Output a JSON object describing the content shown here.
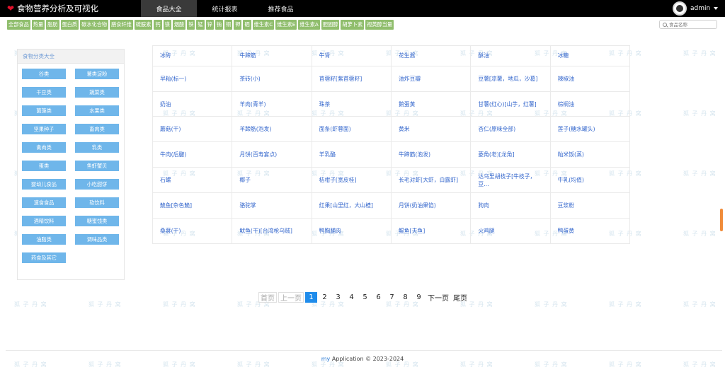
{
  "app": {
    "title": "食物营养分析及可视化"
  },
  "nav": {
    "tabs": [
      {
        "label": "食品大全"
      },
      {
        "label": "统计报表"
      },
      {
        "label": "推荐食品"
      }
    ]
  },
  "user": {
    "name": "admin"
  },
  "categories": [
    "全部食品",
    "热量",
    "脂肪",
    "蛋白质",
    "碳水化合物",
    "膳食纤维",
    "硫胺素",
    "钙",
    "镁",
    "烟酸",
    "铁",
    "锰",
    "锌",
    "钠",
    "铜",
    "钾",
    "硒",
    "维生素C",
    "维生素E",
    "维生素A",
    "胆固醇",
    "胡萝卜素",
    "视黄醇当量"
  ],
  "search": {
    "placeholder": "食品名称"
  },
  "sidebar": {
    "title": "食物分类大全",
    "items": [
      "谷类",
      "薯类淀粉",
      "干豆类",
      "蔬菜类",
      "菌藻类",
      "水果类",
      "坚果种子",
      "畜肉类",
      "禽肉类",
      "乳类",
      "蛋类",
      "鱼虾蟹贝",
      "婴幼儿食品",
      "小吃甜饼",
      "速食食品",
      "软饮料",
      "酒精饮料",
      "糖蜜饯类",
      "油脂类",
      "调味品类",
      "药食及其它"
    ]
  },
  "foods": [
    [
      "冰砖",
      "牛蹄筋",
      "牛肾",
      "花生酱",
      "酥油",
      "冰糖"
    ],
    [
      "早籼(标一)",
      "茶砖(小)",
      "苜蓿籽[紫苜蓿籽]",
      "油炸豆瓣",
      "豆薯[凉薯，地瓜，沙葛]",
      "辣椒油"
    ],
    [
      "奶油",
      "羊肉(青羊)",
      "珠茶",
      "鹅蛋黄",
      "甘薯(红心)[山芋，红薯]",
      "棕榈油"
    ],
    [
      "蘑菇(干)",
      "羊蹄筋(泡发)",
      "面条(虾蓉面)",
      "黄米",
      "杏仁(原味全部)",
      "莲子(糖水罐头)"
    ],
    [
      "牛肉(后腱)",
      "月饼(百寿宴点)",
      "羊乳酪",
      "牛蹄筋(泡发)",
      "菱角(老)[龙角]",
      "籼米饭(蒸)"
    ],
    [
      "石螺",
      "椰子",
      "桔柑子[宽皮桂]",
      "长毛对虾[大虾，白露虾]",
      "达乌里胡枝子[牛枝子，豆...",
      "牛乳(均值)"
    ],
    [
      "鮠鱼[杂色鮠]",
      "骆驼掌",
      "红果[山里红，大山楂]",
      "月饼(奶油果馅)",
      "狗肉",
      "豆浆粉"
    ],
    [
      "桑葚(干)",
      "鱿鱼(干)[台湾枪乌贼]",
      "鸭胸脯肉",
      "鲲鱼[夫鱼]",
      "火鸡腿",
      "鸭蛋黄"
    ]
  ],
  "pagination": {
    "first": "首页",
    "prev": "上一页",
    "pages": [
      "1",
      "2",
      "3",
      "4",
      "5",
      "6",
      "7",
      "8",
      "9"
    ],
    "current": "1",
    "next": "下一页",
    "last": "尾页"
  },
  "footer": {
    "brand": "my",
    "text": "Application © 2023-2024"
  },
  "watermark": {
    "text": "狐 子 丹 窝"
  },
  "colors": {
    "topbar": "#000000",
    "chip": "#90be6d",
    "side_button": "#6fb6ea",
    "link": "#3366cc",
    "page_current": "#1f8ceb",
    "heart": "#e0112b"
  }
}
